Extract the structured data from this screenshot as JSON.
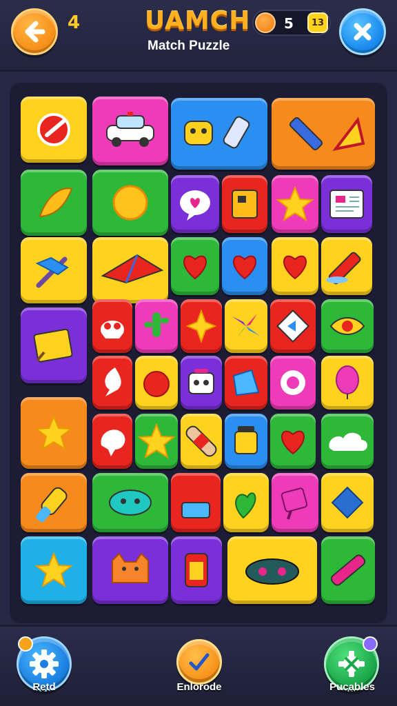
{
  "header": {
    "level": "4",
    "title": "UAMCH",
    "subtitle": "Match Puzzle",
    "coins": "5",
    "gems": "13"
  },
  "footer": {
    "left_label": "Retd",
    "middle_label": "Enlorode",
    "right_label": "Pucables"
  },
  "colors": {
    "background": "#262744",
    "title": "#ffb020",
    "yellow": "#ffd21f",
    "green": "#2eb83a",
    "pink": "#ee3bb8",
    "blue": "#2a8ff0",
    "orange": "#f78a1d",
    "red": "#e8251e",
    "purple": "#7a2fd8",
    "cyan": "#1fb0e8"
  },
  "tiles": [
    {
      "color": "yellow",
      "icon": "meat-icon"
    },
    {
      "color": "pink",
      "icon": "car-icon"
    },
    {
      "color": "blue",
      "icon": "robot-and-jar-icon"
    },
    {
      "color": "orange",
      "icon": "pencil-and-triangle-icon"
    },
    {
      "color": "green",
      "icon": "leaf-icon"
    },
    {
      "color": "green",
      "icon": "sun-icon"
    },
    {
      "color": "purple",
      "icon": "heart-bubble-icon"
    },
    {
      "color": "red",
      "icon": "card-icon"
    },
    {
      "color": "pink",
      "icon": "star-icon"
    },
    {
      "color": "purple",
      "icon": "picture-icon"
    },
    {
      "color": "yellow",
      "icon": "tools-icon"
    },
    {
      "color": "yellow",
      "icon": "kite-icon"
    },
    {
      "color": "green",
      "icon": "heart-icon"
    },
    {
      "color": "blue",
      "icon": "heart-icon"
    },
    {
      "color": "yellow",
      "icon": "heart-icon"
    },
    {
      "color": "yellow",
      "icon": "crayon-icon"
    },
    {
      "color": "purple",
      "icon": "note-icon"
    },
    {
      "color": "red",
      "icon": "skull-icon"
    },
    {
      "color": "pink",
      "icon": "cactus-icon"
    },
    {
      "color": "red",
      "icon": "sparkle-icon"
    },
    {
      "color": "yellow",
      "icon": "pinwheel-icon"
    },
    {
      "color": "red",
      "icon": "diamond-card-icon"
    },
    {
      "color": "green",
      "icon": "eye-icon"
    },
    {
      "color": "red",
      "icon": "flame-icon"
    },
    {
      "color": "yellow",
      "icon": "apple-icon"
    },
    {
      "color": "purple",
      "icon": "bot-icon"
    },
    {
      "color": "red",
      "icon": "box-icon"
    },
    {
      "color": "pink",
      "icon": "ring-icon"
    },
    {
      "color": "yellow",
      "icon": "balloon-icon"
    },
    {
      "color": "orange",
      "icon": "star-icon"
    },
    {
      "color": "red",
      "icon": "splat-icon"
    },
    {
      "color": "green",
      "icon": "star-icon"
    },
    {
      "color": "yellow",
      "icon": "bandage-icon"
    },
    {
      "color": "blue",
      "icon": "jar-icon"
    },
    {
      "color": "green",
      "icon": "heart-icon"
    },
    {
      "color": "green",
      "icon": "cloud-icon"
    },
    {
      "color": "orange",
      "icon": "popsicle-icon"
    },
    {
      "color": "green",
      "icon": "monster-icon"
    },
    {
      "color": "red",
      "icon": "ball-icon"
    },
    {
      "color": "yellow",
      "icon": "leaf-heart-icon"
    },
    {
      "color": "pink",
      "icon": "candy-icon"
    },
    {
      "color": "yellow",
      "icon": "gem-icon"
    },
    {
      "color": "cyan",
      "icon": "star-icon"
    },
    {
      "color": "purple",
      "icon": "cat-icon"
    },
    {
      "color": "purple",
      "icon": "phone-icon"
    },
    {
      "color": "yellow",
      "icon": "bug-icon"
    },
    {
      "color": "green",
      "icon": "pen-icon"
    }
  ]
}
